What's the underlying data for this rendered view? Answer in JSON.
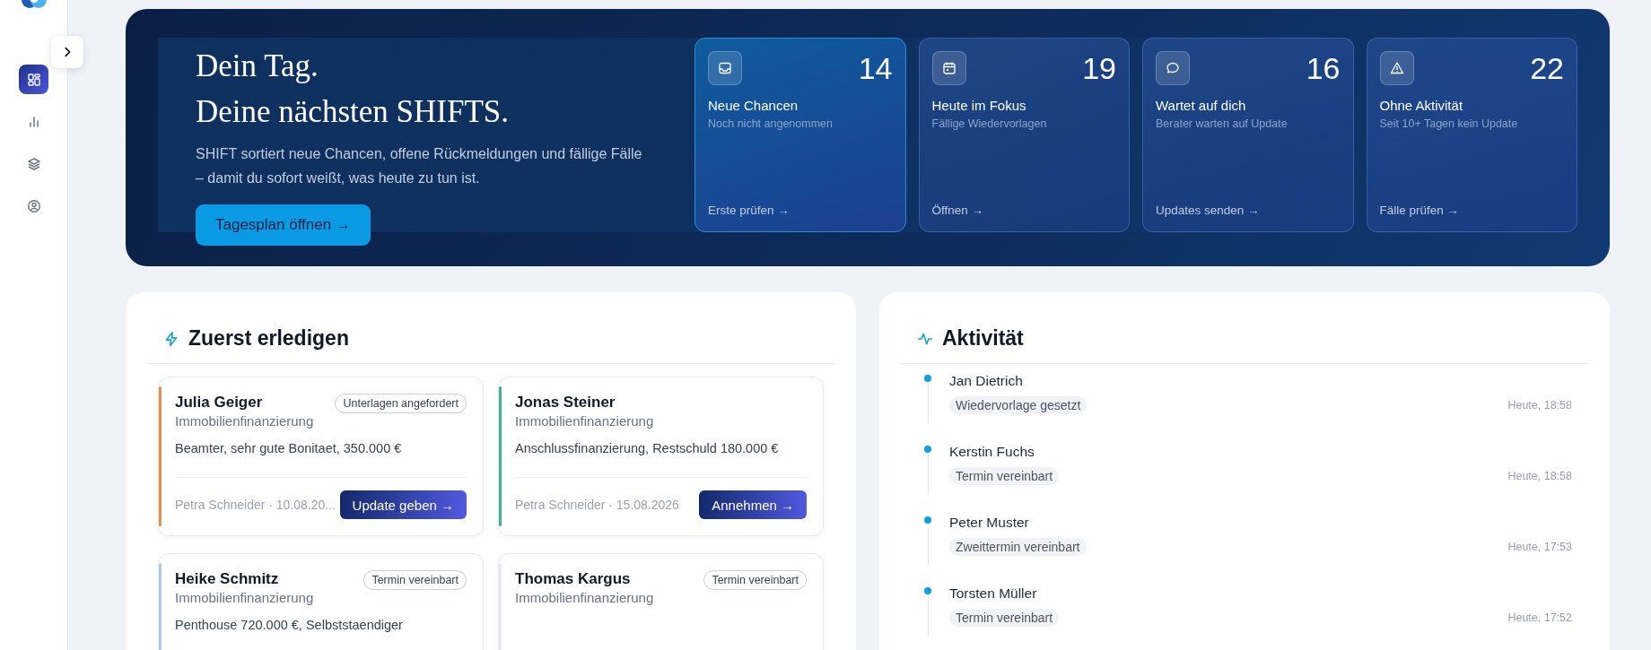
{
  "sidebar": {
    "items": [
      {
        "kind": "dashboard",
        "selected": true
      },
      {
        "kind": "chart",
        "selected": false
      },
      {
        "kind": "layers",
        "selected": false
      },
      {
        "kind": "user",
        "selected": false
      }
    ]
  },
  "hero": {
    "title_lines": [
      "Dein Tag.",
      "Deine nächsten SHIFTS."
    ],
    "description": "SHIFT sortiert neue Chancen, offene Rückmeldungen und fällige Fälle – damit du sofort weißt, was heute zu tun ist.",
    "button": "Tagesplan öffnen →",
    "stats": [
      {
        "kind": "inbox",
        "count": "14",
        "title": "Neue Chancen",
        "subtitle": "Noch nicht angenommen",
        "link": "Erste prüfen →",
        "selected": true
      },
      {
        "kind": "calendar",
        "count": "19",
        "title": "Heute im Fokus",
        "subtitle": "Fällige Wiedervorlagen",
        "link": "Öffnen →",
        "selected": false
      },
      {
        "kind": "chat",
        "count": "16",
        "title": "Wartet auf dich",
        "subtitle": "Berater warten auf Update",
        "link": "Updates senden →",
        "selected": false
      },
      {
        "kind": "warning",
        "count": "22",
        "title": "Ohne Aktivität",
        "subtitle": "Seit 10+ Tagen kein Update",
        "link": "Fälle prüfen →",
        "selected": false
      }
    ]
  },
  "todo": {
    "title": "Zuerst erledigen",
    "cards": [
      {
        "name": "Julia Geiger",
        "product": "Immobilienfinanzierung",
        "status": "Unterlagen angefordert",
        "details": "Beamter, sehr gute Bonitaet, 350.000 €",
        "meta": "Petra Schneider · 10.08.20...",
        "action": "Update geben →",
        "color": "#e0924a"
      },
      {
        "name": "Jonas Steiner",
        "product": "Immobilienfinanzierung",
        "details": "Anschlussfinanzierung, Restschuld 180.000 €",
        "meta": "Petra Schneider · 15.08.2026",
        "action": "Annehmen →",
        "color": "#3db58a"
      },
      {
        "name": "Heike Schmitz",
        "product": "Immobilienfinanzierung",
        "status": "Termin vereinbart",
        "details": "Penthouse 720.000 €, Selbststaendiger",
        "color": "#a9cdea"
      },
      {
        "name": "Thomas Kargus",
        "product": "Immobilienfinanzierung",
        "status": "Termin vereinbart",
        "color": "#e6e9ef"
      }
    ]
  },
  "activity": {
    "title": "Aktivität",
    "items": [
      {
        "name": "Jan Dietrich",
        "tag": "Wiedervorlage gesetzt",
        "time": "Heute, 18:58"
      },
      {
        "name": "Kerstin Fuchs",
        "tag": "Termin vereinbart",
        "time": "Heute, 18:58"
      },
      {
        "name": "Peter Muster",
        "tag": "Zweittermin vereinbart",
        "time": "Heute, 17:53"
      },
      {
        "name": "Torsten Müller",
        "tag": "Termin vereinbart",
        "time": "Heute, 17:52"
      }
    ]
  }
}
